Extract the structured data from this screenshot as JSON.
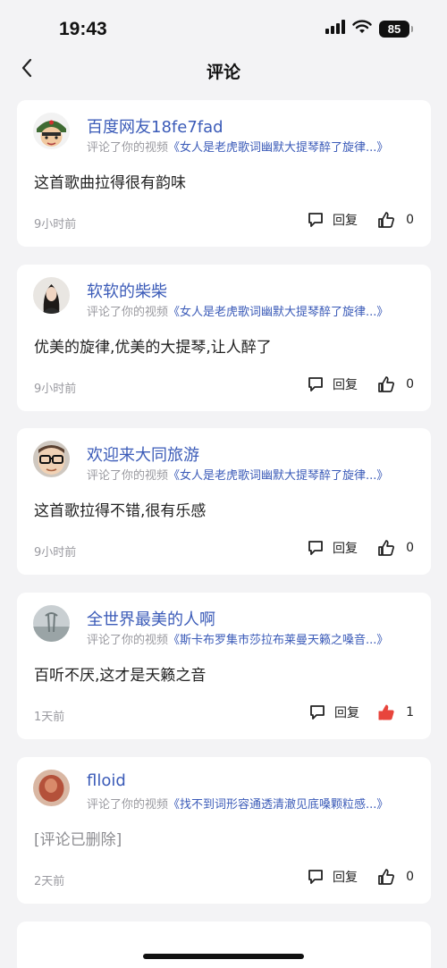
{
  "status_bar": {
    "time": "19:43",
    "battery": "85"
  },
  "header": {
    "title": "评论"
  },
  "comments": [
    {
      "username": "百度网友18fe7fad",
      "prefix": "评论了你的视频",
      "video": "《女人是老虎歌词幽默大提琴醉了旋律...》",
      "text": "这首歌曲拉得很有韵味",
      "time": "9小时前",
      "reply_label": "回复",
      "likes": "0",
      "liked": false,
      "deleted": false,
      "avatar": "soldier-avatar"
    },
    {
      "username": "软软的柴柴",
      "prefix": "评论了你的视频",
      "video": "《女人是老虎歌词幽默大提琴醉了旋律...》",
      "text": "优美的旋律,优美的大提琴,让人醉了",
      "time": "9小时前",
      "reply_label": "回复",
      "likes": "0",
      "liked": false,
      "deleted": false,
      "avatar": "woman-avatar"
    },
    {
      "username": "欢迎来大同旅游",
      "prefix": "评论了你的视频",
      "video": "《女人是老虎歌词幽默大提琴醉了旋律...》",
      "text": "这首歌拉得不错,很有乐感",
      "time": "9小时前",
      "reply_label": "回复",
      "likes": "0",
      "liked": false,
      "deleted": false,
      "avatar": "child-glasses-avatar"
    },
    {
      "username": "全世界最美的人啊",
      "prefix": "评论了你的视频",
      "video": "《斯卡布罗集市莎拉布莱曼天籁之嗓音...》",
      "text": "百听不厌,这才是天籁之音",
      "time": "1天前",
      "reply_label": "回复",
      "likes": "1",
      "liked": true,
      "deleted": false,
      "avatar": "landscape-avatar"
    },
    {
      "username": "flloid",
      "prefix": "评论了你的视频",
      "video": "《找不到词形容通透清澈见底嗓颗粒感...》",
      "text": "[评论已删除]",
      "time": "2天前",
      "reply_label": "回复",
      "likes": "0",
      "liked": false,
      "deleted": true,
      "avatar": "red-blur-avatar"
    }
  ],
  "colors": {
    "link": "#3b5bb8",
    "liked": "#e8453c",
    "background": "#f3f3f5"
  }
}
